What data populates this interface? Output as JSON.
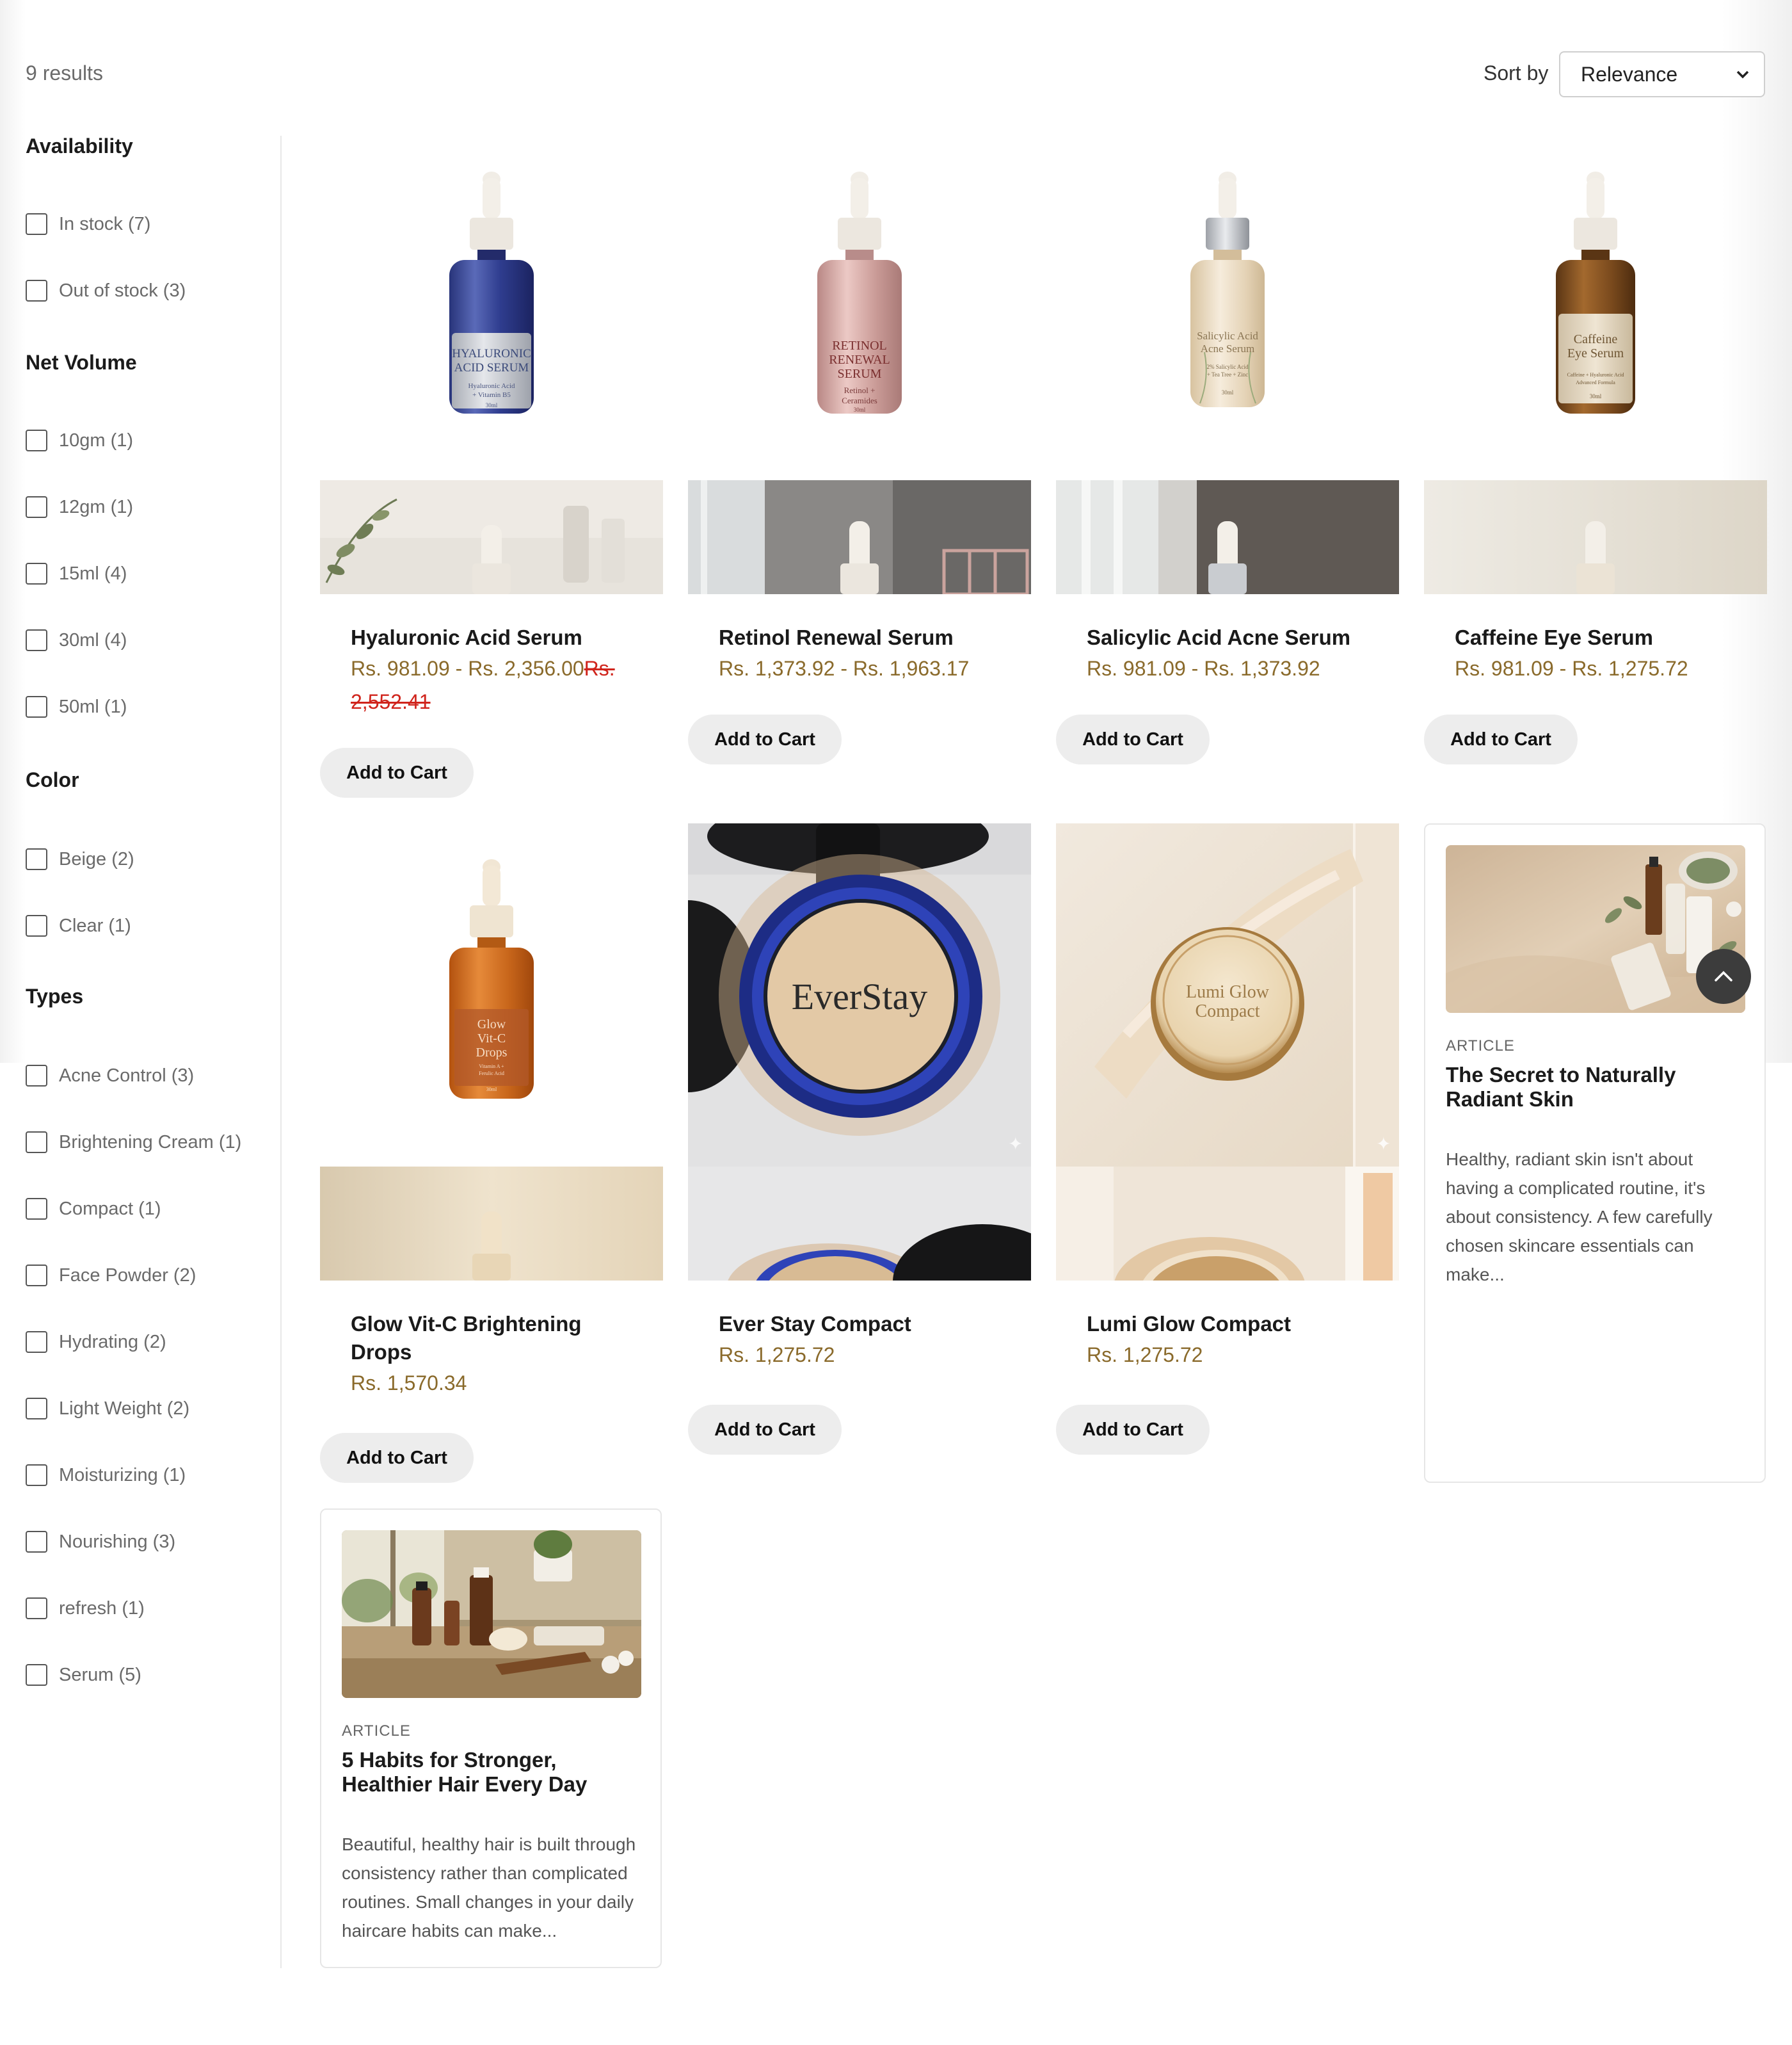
{
  "header": {
    "results": "9 results",
    "sort_label": "Sort by",
    "sort_value": "Relevance"
  },
  "filters": {
    "availability": {
      "title": "Availability",
      "items": [
        "In stock (7)",
        "Out of stock (3)"
      ]
    },
    "net_volume": {
      "title": "Net Volume",
      "items": [
        "10gm (1)",
        "12gm (1)",
        "15ml (4)",
        "30ml (4)",
        "50ml (1)"
      ]
    },
    "color": {
      "title": "Color",
      "items": [
        "Beige (2)",
        "Clear (1)"
      ]
    },
    "types": {
      "title": "Types",
      "items": [
        "Acne Control (3)",
        "Brightening Cream (1)",
        "Compact (1)",
        "Face Powder (2)",
        "Hydrating (2)",
        "Light Weight (2)",
        "Moisturizing (1)",
        "Nourishing (3)",
        "refresh (1)",
        "Serum (5)"
      ]
    }
  },
  "products": [
    {
      "name": "Hyaluronic Acid Serum",
      "price": "Rs. 981.09 - Rs. 2,356.00",
      "compare": "Rs. 2,552.41",
      "label1": "HYALURONIC",
      "label2": "ACID SERUM",
      "label3": "Hyaluronic Acid",
      "label4": "+ Vitamin B5",
      "label5": "30ml"
    },
    {
      "name": "Retinol Renewal Serum",
      "price": "Rs. 1,373.92 - Rs. 1,963.17",
      "label1": "RETINOL",
      "label2": "RENEWAL",
      "label3": "SERUM",
      "label4": "Retinol +",
      "label5": "Ceramides",
      "label6": "30ml"
    },
    {
      "name": "Salicylic Acid Acne Serum",
      "price": "Rs. 981.09 - Rs. 1,373.92",
      "label1": "Salicylic Acid",
      "label2": "Acne Serum",
      "label3": "2% Salicylic Acid",
      "label4": "+ Tea Tree + Zinc",
      "label5": "30ml"
    },
    {
      "name": "Caffeine Eye Serum",
      "price": "Rs. 981.09 - Rs. 1,275.72",
      "label1": "Caffeine",
      "label2": "Eye Serum",
      "label3": "Caffeine + Hyaluronic Acid",
      "label4": "Advanced Formula",
      "label5": "30ml"
    },
    {
      "name": "Glow Vit-C Brightening Drops",
      "price": "Rs. 1,570.34",
      "label1": "Glow",
      "label2": "Vit-C",
      "label3": "Drops",
      "label4": "Vitamin A +",
      "label5": "Ferulic Acid",
      "label6": "30ml"
    },
    {
      "name": "Ever Stay Compact",
      "price": "Rs. 1,275.72",
      "label1": "EverStay"
    },
    {
      "name": "Lumi Glow Compact",
      "price": "Rs. 1,275.72",
      "label1": "Lumi Glow",
      "label2": "Compact"
    }
  ],
  "add_to_cart": "Add to Cart",
  "articles": [
    {
      "tag": "ARTICLE",
      "title": "The Secret to Naturally Radiant Skin",
      "excerpt": "Healthy, radiant skin isn't about having a complicated routine, it's about consistency. A few carefully chosen skincare essentials can make..."
    },
    {
      "tag": "ARTICLE",
      "title": "5 Habits for Stronger, Healthier Hair Every Day",
      "excerpt": "Beautiful, healthy hair is built through consistency rather than complicated routines. Small changes in your daily haircare habits can make..."
    }
  ],
  "icons": {
    "sort": "chevron-down-icon",
    "scroll": "chevron-up-icon"
  }
}
